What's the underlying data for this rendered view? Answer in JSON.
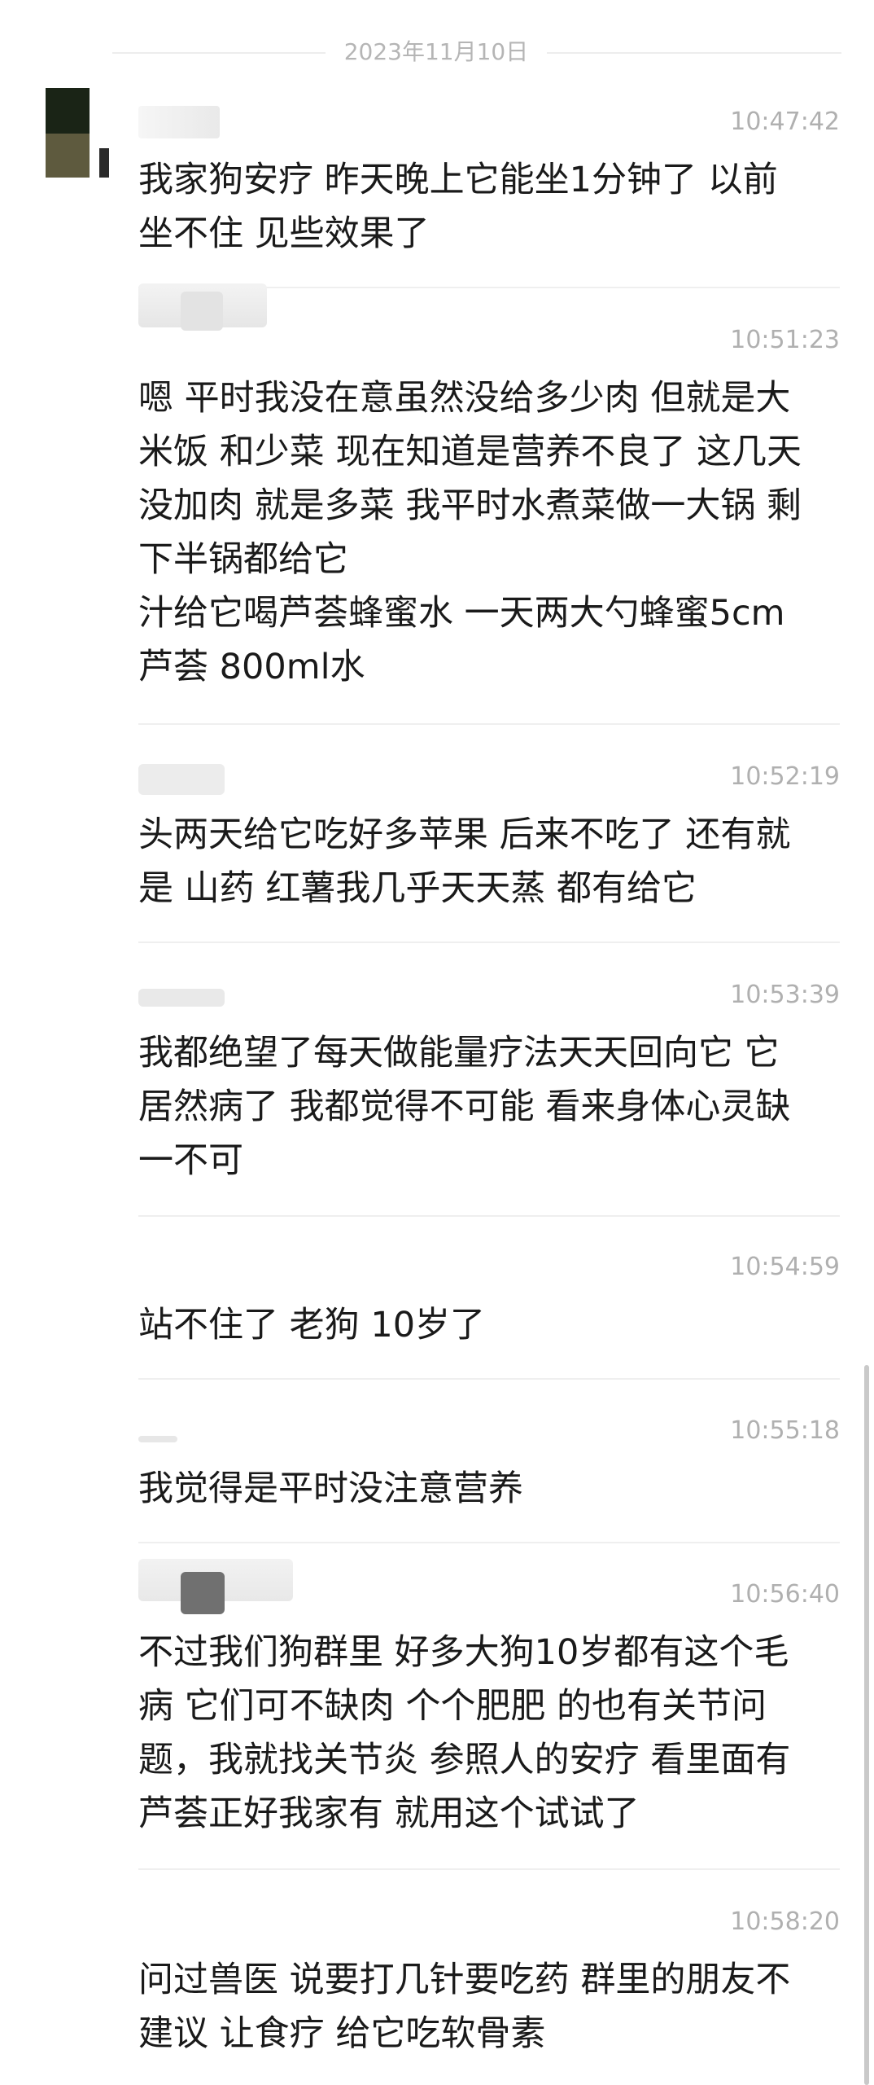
{
  "date_separator": "2023年11月10日",
  "messages": [
    {
      "time": "10:47:42",
      "text": "我家狗安疗 昨天晚上它能坐1分钟了 以前\n坐不住 见些效果了"
    },
    {
      "time": "10:51:23",
      "text": "嗯 平时我没在意虽然没给多少肉 但就是大\n米饭 和少菜 现在知道是营养不良了 这几天\n没加肉 就是多菜 我平时水煮菜做一大锅 剩\n下半锅都给它\n汁给它喝芦荟蜂蜜水 一天两大勺蜂蜜5cm\n芦荟 800ml水"
    },
    {
      "time": "10:52:19",
      "text": "头两天给它吃好多苹果 后来不吃了 还有就\n是 山药 红薯我几乎天天蒸 都有给它"
    },
    {
      "time": "10:53:39",
      "text": "我都绝望了每天做能量疗法天天回向它 它\n居然病了 我都觉得不可能 看来身体心灵缺\n一不可"
    },
    {
      "time": "10:54:59",
      "text": "站不住了 老狗 10岁了"
    },
    {
      "time": "10:55:18",
      "text": "我觉得是平时没注意营养"
    },
    {
      "time": "10:56:40",
      "text": "不过我们狗群里 好多大狗10岁都有这个毛\n病 它们可不缺肉 个个肥肥 的也有关节问\n题，我就找关节炎 参照人的安疗 看里面有\n芦荟正好我家有 就用这个试试了"
    },
    {
      "time": "10:58:20",
      "text": "问过兽医 说要打几针要吃药 群里的朋友不\n建议 让食疗 给它吃软骨素"
    }
  ]
}
